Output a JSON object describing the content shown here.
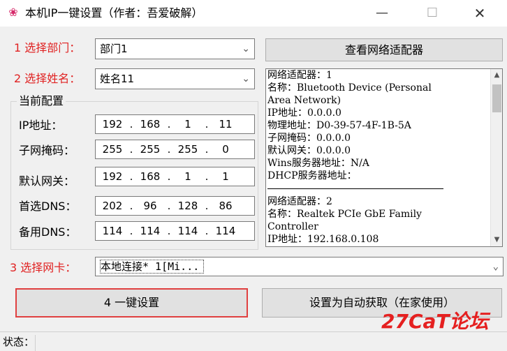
{
  "window": {
    "title": "本机IP一键设置（作者：吾爱破解）",
    "app_icon": "flower-icon",
    "minimize": "—",
    "maximize": "☐",
    "close": "✕"
  },
  "form": {
    "dept_label": "1 选择部门：",
    "dept_value": "部门1",
    "name_label": "2 选择姓名：",
    "name_value": "姓名11",
    "nic_label": "3 选择网卡：",
    "nic_value": "本地连接* 1[Mi..."
  },
  "group": {
    "title": "当前配置",
    "rows": [
      {
        "label": "IP地址：",
        "octets": [
          "192",
          "168",
          "1",
          "11"
        ]
      },
      {
        "label": "子网掩码：",
        "octets": [
          "255",
          "255",
          "255",
          "0"
        ]
      },
      {
        "label": "默认网关：",
        "octets": [
          "192",
          "168",
          "1",
          "1"
        ]
      },
      {
        "label": "首选DNS：",
        "octets": [
          "202",
          "96",
          "128",
          "86"
        ]
      },
      {
        "label": "备用DNS：",
        "octets": [
          "114",
          "114",
          "114",
          "114"
        ]
      }
    ]
  },
  "buttons": {
    "view_adapters": "查看网络适配器",
    "apply": "4 一键设置",
    "auto": "设置为自动获取（在家使用）"
  },
  "adapter_info": {
    "lines": [
      "网络适配器：1",
      "名称：Bluetooth Device (Personal",
      "Area Network)",
      "IP地址：0.0.0.0",
      "物理地址：D0-39-57-4F-1B-5A",
      "子网掩码：0.0.0.0",
      "默认网关：0.0.0.0",
      "Wins服务器地址：N/A",
      "DHCP服务器地址：",
      "",
      "网络适配器：2",
      "名称：Realtek PCIe GbE Family",
      "Controller",
      "IP地址：192.168.0.108"
    ]
  },
  "status": {
    "label": "状态："
  },
  "watermark": {
    "text": "27CaT论坛"
  }
}
